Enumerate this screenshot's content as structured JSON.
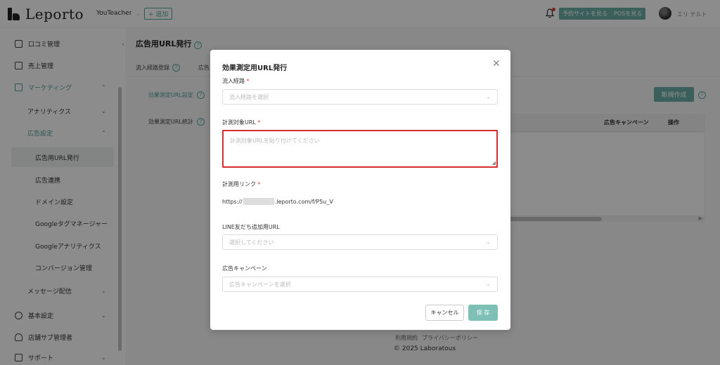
{
  "header": {
    "brand": "Leporto",
    "store": "YouTeacher",
    "add_label": "+ 追加",
    "reserve_btn": "予約サイトを見る",
    "pos_btn": "POSを見る",
    "user_name": "エリ テルト"
  },
  "sidebar": {
    "review": "口コミ管理",
    "sales": "売上管理",
    "marketing": "マーケティング",
    "analytics": "アナリティクス",
    "ad_settings": "広告設定",
    "ad_url": "広告用URL発行",
    "ad_link": "広告連携",
    "domain": "ドメイン設定",
    "gtm": "Googleタグマネージャー",
    "ga": "Googleアナリティクス",
    "conversion": "コンバージョン管理",
    "message": "メッセージ配信",
    "basic": "基本設定",
    "sub_admin": "店舗サブ管理者",
    "support": "サポート"
  },
  "main": {
    "title": "広告用URL発行",
    "tab1": "流入経路登録",
    "tab2": "広告",
    "sub1": "効果測定URL設定",
    "sub2": "効果測定URL統計",
    "new_btn": "新規作成",
    "col_campaign": "広告キャンペーン",
    "col_action": "操作"
  },
  "footer": {
    "terms": "利用規約",
    "privacy": "プライバシーポリシー",
    "copyright": "2025 Laboratous"
  },
  "modal": {
    "title": "効果測定用URL発行",
    "route_label": "流入経路",
    "route_placeholder": "流入経路を選択",
    "target_label": "計測対象URL",
    "target_placeholder": "計測対象URLを貼り付けてください",
    "link_label": "計測用リンク",
    "link_prefix": "https://",
    "link_suffix": ".leporto.com/f/P5u_V",
    "line_label": "LINE友だち追加用URL",
    "line_placeholder": "選択してください",
    "campaign_label": "広告キャンペーン",
    "campaign_placeholder": "広告キャンペーンを選択",
    "required_mark": "*",
    "cancel": "キャンセル",
    "save": "保 存"
  },
  "colors": {
    "accent": "#6cb0a6",
    "error": "#d32f2f"
  }
}
